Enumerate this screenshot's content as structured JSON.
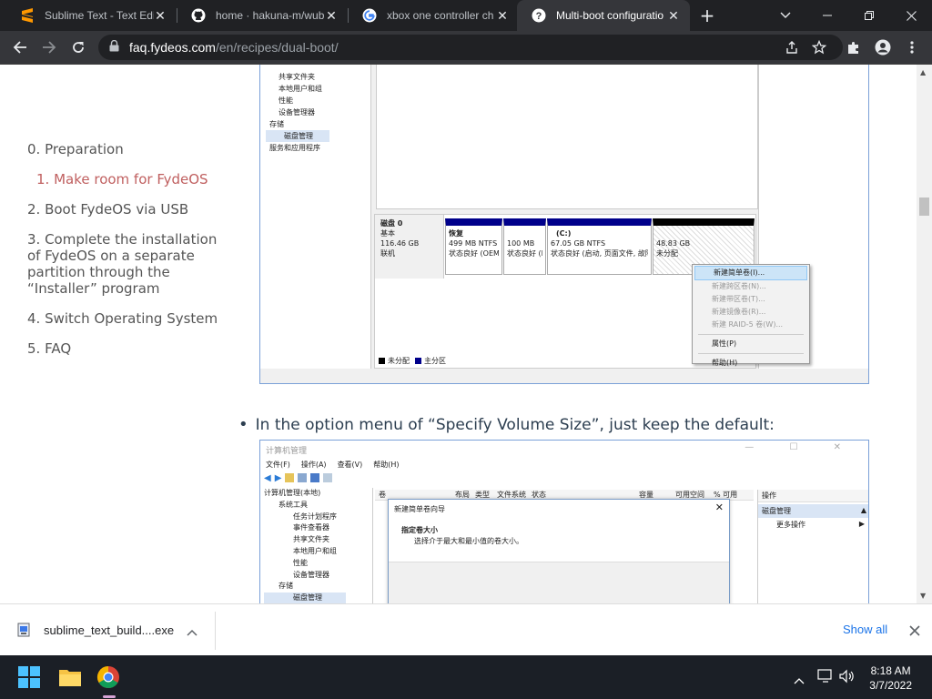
{
  "browser": {
    "tabs": [
      {
        "title": "Sublime Text - Text Editi",
        "icon": "sublime-icon"
      },
      {
        "title": "home · hakuna-m/wub",
        "icon": "github-icon"
      },
      {
        "title": "xbox one controller ch",
        "icon": "google-icon"
      },
      {
        "title": "Multi-boot configuratio",
        "icon": "fydeos-icon",
        "active": true
      }
    ],
    "url_host": "faq.fydeos.com",
    "url_path": "/en/recipes/dual-boot/"
  },
  "toc": [
    {
      "label": "0. Preparation"
    },
    {
      "label": "1. Make room for FydeOS",
      "active": true
    },
    {
      "label": "2. Boot FydeOS via USB"
    },
    {
      "label": "3. Complete the installation of FydeOS on a separate partition through the “Installer” program"
    },
    {
      "label": "4. Switch Operating System"
    },
    {
      "label": "5. FAQ"
    }
  ],
  "screenshot1": {
    "tree_items": [
      "共享文件夹",
      "本地用户和组",
      "性能",
      "设备管理器",
      "存储",
      "磁盘管理",
      "服务和应用程序"
    ],
    "disk_label": "磁盘 0",
    "disk_type": "基本",
    "disk_size": "116.46 GB",
    "disk_status": "联机",
    "partitions": [
      {
        "name": "恢复",
        "size": "499 MB NTFS",
        "status": "状态良好 (OEM"
      },
      {
        "name": "",
        "size": "100 MB",
        "status": "状态良好 (I"
      },
      {
        "name": "(C:)",
        "size": "67.05 GB NTFS",
        "status": "状态良好 (启动, 页面文件, 故障"
      },
      {
        "name": "",
        "size": "48.83 GB",
        "status": "未分配"
      }
    ],
    "context_menu": [
      "新建简单卷(I)...",
      "新建跨区卷(N)...",
      "新建带区卷(T)...",
      "新建镜像卷(R)...",
      "新建 RAID-5 卷(W)...",
      "属性(P)",
      "帮助(H)"
    ],
    "legend_unallocated": "未分配",
    "legend_primary": "主分区"
  },
  "bullet_text": "In the option menu of “Specify Volume Size”, just keep the default:",
  "screenshot2": {
    "title": "计算机管理",
    "menu": [
      "文件(F)",
      "操作(A)",
      "查看(V)",
      "帮助(H)"
    ],
    "tree": [
      "计算机管理(本地)",
      "系统工具",
      "任务计划程序",
      "事件查看器",
      "共享文件夹",
      "本地用户和组",
      "性能",
      "设备管理器",
      "存储",
      "磁盘管理"
    ],
    "columns": [
      "卷",
      "布局",
      "类型",
      "文件系统",
      "状态",
      "容量",
      "可用空间",
      "% 可用"
    ],
    "actions_title": "操作",
    "actions_item": "磁盘管理",
    "actions_more": "更多操作",
    "wizard_title": "新建简单卷向导",
    "wizard_heading": "指定卷大小",
    "wizard_sub": "选择介于最大和最小值的卷大小。",
    "pct_values": [
      "%",
      "%"
    ]
  },
  "downloads": {
    "file": "sublime_text_build....exe",
    "show_all": "Show all"
  },
  "taskbar": {
    "time": "8:18 AM",
    "date": "3/7/2022"
  }
}
